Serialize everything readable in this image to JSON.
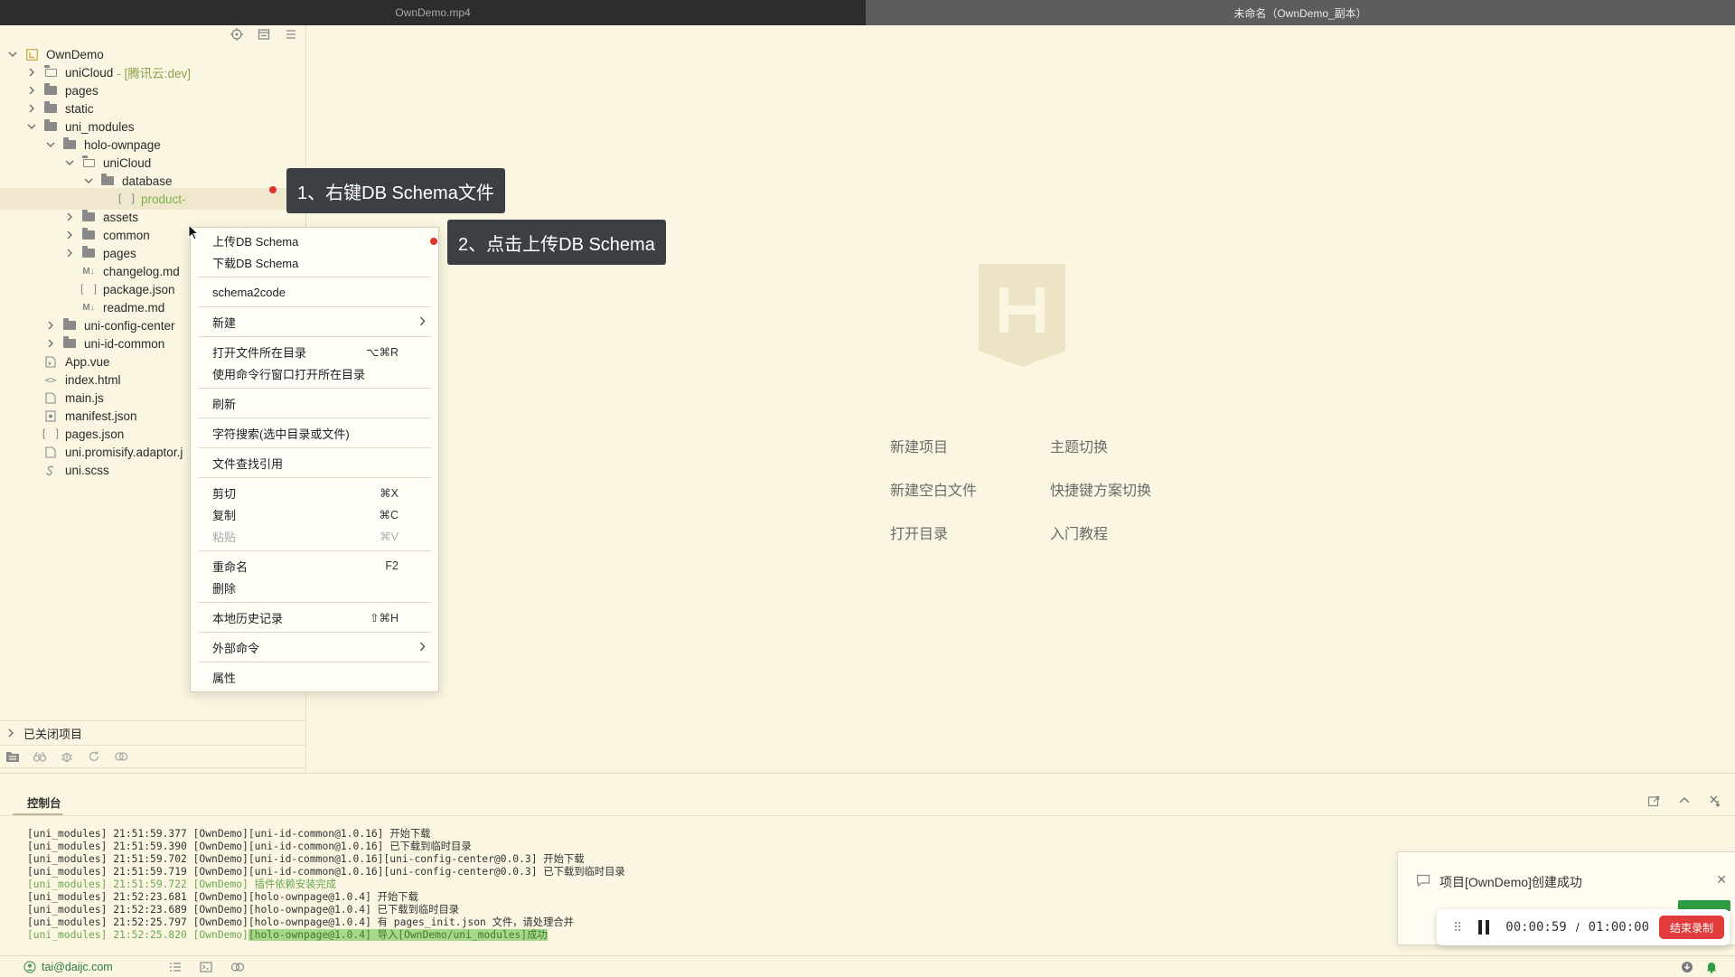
{
  "window": {
    "left_tab_title": "OwnDemo.mp4",
    "right_tab_title": "未命名（OwnDemo_副本）"
  },
  "sidebar": {
    "toolbar_icons": [
      "locate-icon",
      "collapse-icon",
      "menu-icon"
    ],
    "tree": [
      {
        "label": "OwnDemo",
        "suffix": "",
        "icon": "project-icon",
        "expanded": true
      },
      {
        "label": "uniCloud",
        "suffix": "- [腾讯云:dev]",
        "icon": "folder-open-icon",
        "expanded": false
      },
      {
        "label": "pages",
        "suffix": "",
        "icon": "folder-icon",
        "expanded": false
      },
      {
        "label": "static",
        "suffix": "",
        "icon": "folder-icon",
        "expanded": false
      },
      {
        "label": "uni_modules",
        "suffix": "",
        "icon": "folder-icon",
        "expanded": true
      },
      {
        "label": "holo-ownpage",
        "suffix": "",
        "icon": "folder-icon",
        "expanded": true
      },
      {
        "label": "uniCloud",
        "suffix": "",
        "icon": "folder-open-icon",
        "expanded": true
      },
      {
        "label": "database",
        "suffix": "",
        "icon": "folder-icon",
        "expanded": true
      },
      {
        "label": "product-",
        "suffix": "",
        "icon": "json-icon",
        "expanded": null
      },
      {
        "label": "assets",
        "suffix": "",
        "icon": "folder-icon",
        "expanded": false
      },
      {
        "label": "common",
        "suffix": "",
        "icon": "folder-icon",
        "expanded": false
      },
      {
        "label": "pages",
        "suffix": "",
        "icon": "folder-icon",
        "expanded": false
      },
      {
        "label": "changelog.md",
        "suffix": "",
        "icon": "markdown-icon",
        "expanded": null
      },
      {
        "label": "package.json",
        "suffix": "",
        "icon": "json-icon",
        "expanded": null
      },
      {
        "label": "readme.md",
        "suffix": "",
        "icon": "markdown-icon",
        "expanded": null
      },
      {
        "label": "uni-config-center",
        "suffix": "",
        "icon": "folder-icon",
        "expanded": false
      },
      {
        "label": "uni-id-common",
        "suffix": "",
        "icon": "folder-icon",
        "expanded": false
      },
      {
        "label": "App.vue",
        "suffix": "",
        "icon": "vue-file-icon",
        "expanded": null
      },
      {
        "label": "index.html",
        "suffix": "",
        "icon": "html-file-icon",
        "expanded": null
      },
      {
        "label": "main.js",
        "suffix": "",
        "icon": "js-file-icon",
        "expanded": null
      },
      {
        "label": "manifest.json",
        "suffix": "",
        "icon": "manifest-icon",
        "expanded": null
      },
      {
        "label": "pages.json",
        "suffix": "",
        "icon": "json-icon",
        "expanded": null
      },
      {
        "label": "uni.promisify.adaptor.j",
        "suffix": "",
        "icon": "js-file-icon",
        "expanded": null
      },
      {
        "label": "uni.scss",
        "suffix": "",
        "icon": "scss-file-icon",
        "expanded": null
      }
    ],
    "closed_projects_label": "已关闭项目",
    "bottom_icons": [
      "explorer-icon",
      "binoculars-icon",
      "bug-icon",
      "refresh-icon",
      "plugin-icon"
    ]
  },
  "context_menu": {
    "items": [
      {
        "label": "上传DB Schema",
        "shortcut": "",
        "submenu": false,
        "disabled": false
      },
      {
        "label": "下载DB Schema",
        "shortcut": "",
        "submenu": false,
        "disabled": false
      },
      {
        "label": "schema2code",
        "shortcut": "",
        "submenu": false,
        "disabled": false
      },
      {
        "label": "新建",
        "shortcut": "",
        "submenu": true,
        "disabled": false
      },
      {
        "label": "打开文件所在目录",
        "shortcut": "⌥⌘R",
        "submenu": false,
        "disabled": false
      },
      {
        "label": "使用命令行窗口打开所在目录",
        "shortcut": "",
        "submenu": false,
        "disabled": false
      },
      {
        "label": "刷新",
        "shortcut": "",
        "submenu": false,
        "disabled": false
      },
      {
        "label": "字符搜索(选中目录或文件)",
        "shortcut": "",
        "submenu": false,
        "disabled": false
      },
      {
        "label": "文件查找引用",
        "shortcut": "",
        "submenu": false,
        "disabled": false
      },
      {
        "label": "剪切",
        "shortcut": "⌘X",
        "submenu": false,
        "disabled": false
      },
      {
        "label": "复制",
        "shortcut": "⌘C",
        "submenu": false,
        "disabled": false
      },
      {
        "label": "粘贴",
        "shortcut": "⌘V",
        "submenu": false,
        "disabled": true
      },
      {
        "label": "重命名",
        "shortcut": "F2",
        "submenu": false,
        "disabled": false
      },
      {
        "label": "删除",
        "shortcut": "",
        "submenu": false,
        "disabled": false
      },
      {
        "label": "本地历史记录",
        "shortcut": "⇧⌘H",
        "submenu": false,
        "disabled": false
      },
      {
        "label": "外部命令",
        "shortcut": "",
        "submenu": true,
        "disabled": false
      },
      {
        "label": "属性",
        "shortcut": "",
        "submenu": false,
        "disabled": false
      }
    ]
  },
  "callouts": {
    "step1": "1、右键DB Schema文件",
    "step2": "2、点击上传DB Schema"
  },
  "welcome": {
    "links": [
      {
        "label": "新建项目"
      },
      {
        "label": "主题切换"
      },
      {
        "label": "新建空白文件"
      },
      {
        "label": "快捷键方案切换"
      },
      {
        "label": "打开目录"
      },
      {
        "label": "入门教程"
      }
    ]
  },
  "console": {
    "tab_label": "控制台",
    "lines": [
      {
        "text": "[uni_modules] 21:51:59.377 [OwnDemo][uni-id-common@1.0.16] 开始下载",
        "success": false
      },
      {
        "text": "[uni_modules] 21:51:59.390 [OwnDemo][uni-id-common@1.0.16] 已下载到临时目录",
        "success": false
      },
      {
        "text": "[uni_modules] 21:51:59.702 [OwnDemo][uni-id-common@1.0.16][uni-config-center@0.0.3] 开始下载",
        "success": false
      },
      {
        "text": "[uni_modules] 21:51:59.719 [OwnDemo][uni-id-common@1.0.16][uni-config-center@0.0.3] 已下载到临时目录",
        "success": false
      },
      {
        "text": "[uni_modules] 21:51:59.722 [OwnDemo] 插件依赖安装完成",
        "success": true
      },
      {
        "text": "[uni_modules] 21:52:23.681 [OwnDemo][holo-ownpage@1.0.4] 开始下载",
        "success": false
      },
      {
        "text": "[uni_modules] 21:52:23.689 [OwnDemo][holo-ownpage@1.0.4] 已下载到临时目录",
        "success": false
      },
      {
        "text": "[uni_modules] 21:52:25.797 [OwnDemo][holo-ownpage@1.0.4] 有 pages_init.json 文件，请处理合并",
        "success": false
      }
    ],
    "last_line_prefix": "[uni_modules] 21:52:25.820 [OwnDemo]",
    "last_line_highlight": "[holo-ownpage@1.0.4] 导入[OwnDemo/uni_modules]成功"
  },
  "notification": {
    "message": "项目[OwnDemo]创建成功"
  },
  "recorder": {
    "elapsed": "00:00:59",
    "separator": "/",
    "total": "01:00:00",
    "stop_label": "结束录制"
  },
  "statusbar": {
    "user": "tai@daijc.com"
  },
  "colors": {
    "background": "#fbf6e2",
    "accent_green": "#7cb04c",
    "callout_bg": "#3c3f44",
    "stop_red": "#e23b3b"
  }
}
